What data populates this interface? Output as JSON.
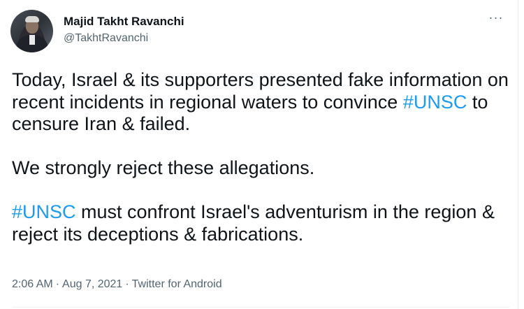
{
  "author": {
    "name": "Majid Takht Ravanchi",
    "handle": "@TakhtRavanchi",
    "avatar_icon": "profile-photo"
  },
  "more_menu": {
    "label": "···",
    "icon": "more-horizontal-icon"
  },
  "tweet": {
    "paragraph1": {
      "before": "Today, Israel & its supporters presented fake information on recent incidents in regional waters to convince ",
      "hashtag": "#UNSC",
      "after": " to censure Iran & failed."
    },
    "paragraph2": "We strongly reject these allegations.",
    "paragraph3": {
      "hashtag": "#UNSC",
      "after": " must confront Israel's adventurism in the region & reject its deceptions & fabrications."
    }
  },
  "meta": {
    "time": "2:06 AM",
    "separator": "·",
    "date": "Aug 7, 2021",
    "source": "Twitter for Android"
  },
  "colors": {
    "hashtag": "#1d9bf0",
    "secondary_text": "#536471",
    "primary_text": "#0f1419"
  }
}
